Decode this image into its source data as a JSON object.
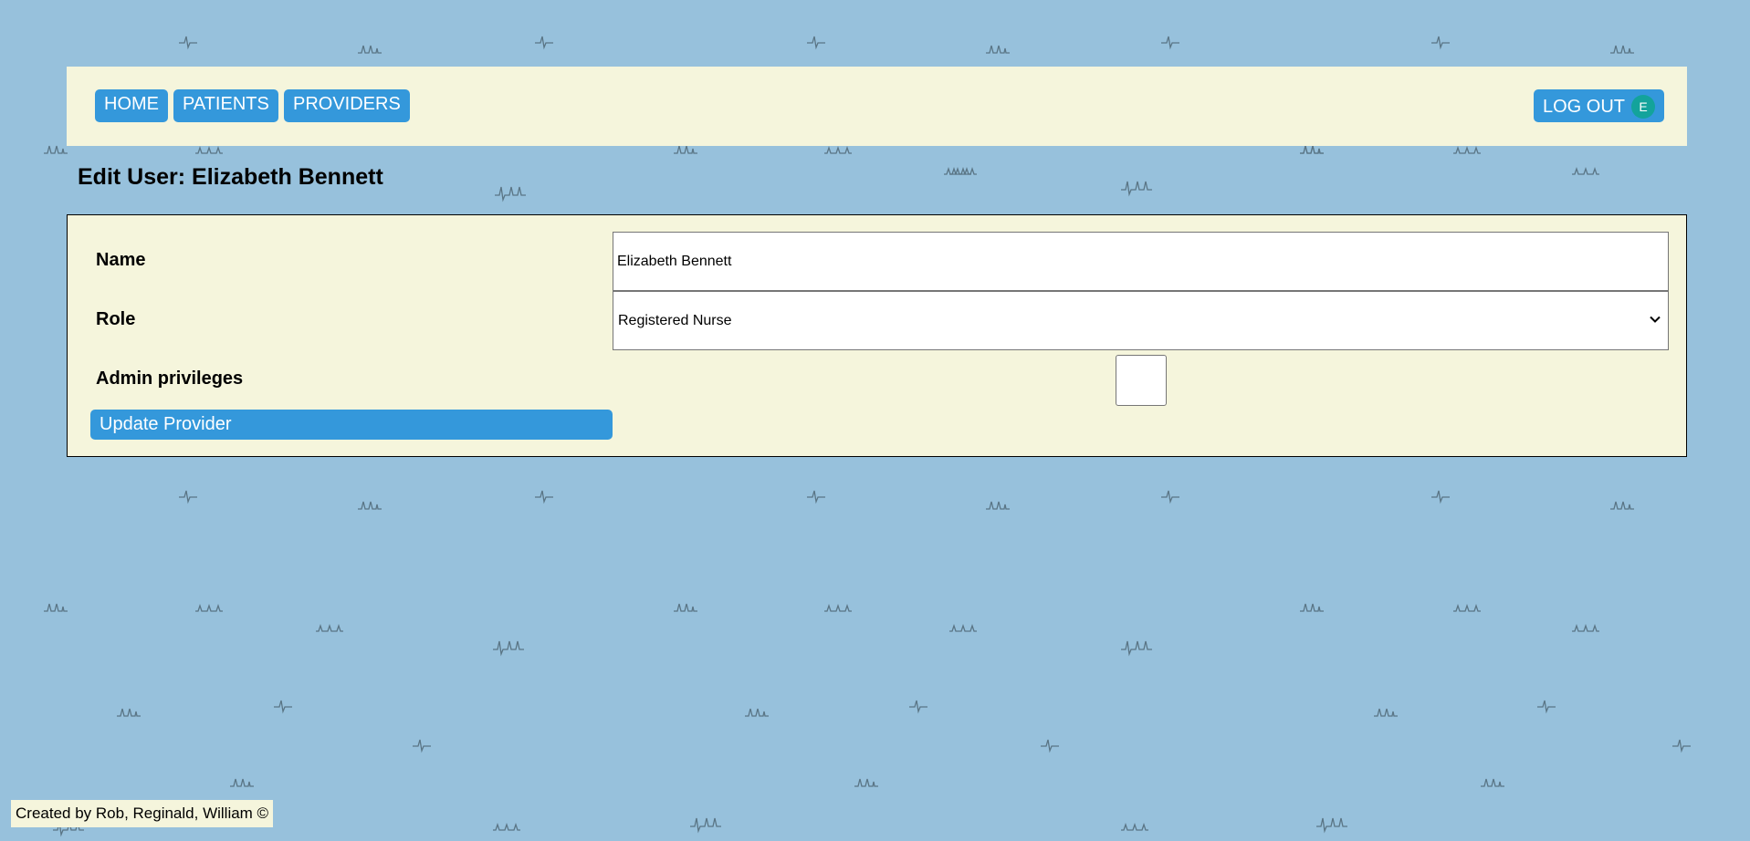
{
  "nav": {
    "home": "HOME",
    "patients": "PATIENTS",
    "providers": "PROVIDERS",
    "logout": "LOG OUT",
    "avatar_initial": "E"
  },
  "page": {
    "title": "Edit User: Elizabeth Bennett"
  },
  "form": {
    "name_label": "Name",
    "name_value": "Elizabeth Bennett",
    "role_label": "Role",
    "role_value": "Registered Nurse",
    "admin_label": "Admin privileges",
    "admin_checked": false,
    "submit_label": "Update Provider"
  },
  "footer": {
    "credit": "Created by Rob, Reginald, William ©"
  },
  "colors": {
    "background": "#97c1dc",
    "panel": "#f5f5dc",
    "button": "#3498db",
    "avatar": "#13a39b",
    "pattern": "#5a7585"
  }
}
